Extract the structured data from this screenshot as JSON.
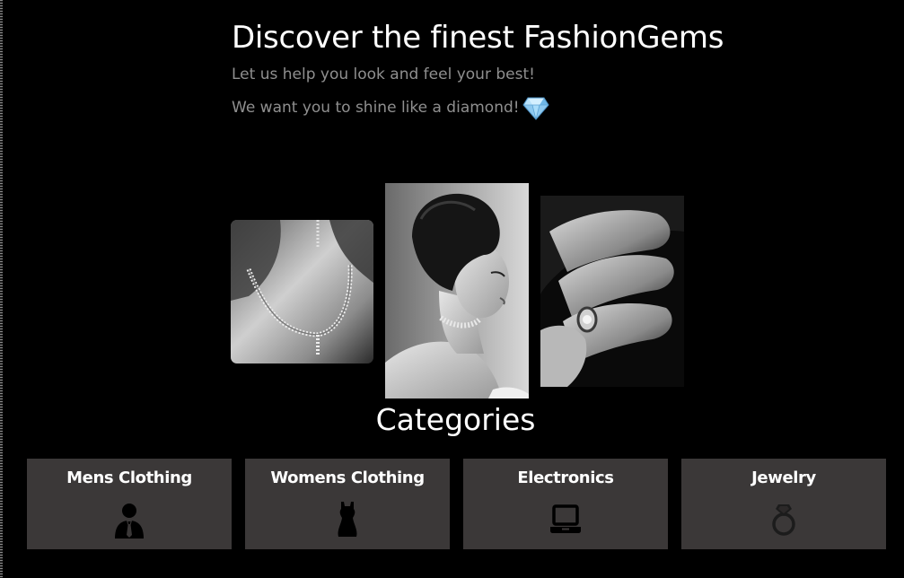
{
  "hero": {
    "title": "Discover the finest FashionGems",
    "line1": "Let us help you look and feel your best!",
    "line2": "We want you to shine like a diamond!",
    "line2_icon": "gem-icon"
  },
  "gallery": {
    "images": [
      {
        "name": "necklace-photo",
        "subject": "necklace on neck",
        "icon": "necklace-image"
      },
      {
        "name": "portrait-photo",
        "subject": "woman with updo wearing choker",
        "icon": "portrait-image"
      },
      {
        "name": "ring-photo",
        "subject": "hand wearing ring",
        "icon": "ring-image"
      }
    ]
  },
  "categories": {
    "title": "Categories",
    "items": [
      {
        "label": "Mens Clothing",
        "icon": "man-in-suit-icon"
      },
      {
        "label": "Womens Clothing",
        "icon": "dress-icon"
      },
      {
        "label": "Electronics",
        "icon": "laptop-icon"
      },
      {
        "label": "Jewelry",
        "icon": "ring-icon"
      }
    ]
  },
  "colors": {
    "background": "#000000",
    "card_background": "#3b3838",
    "subtitle_text": "#8f8f8f",
    "gem": "#8ec9f0"
  }
}
